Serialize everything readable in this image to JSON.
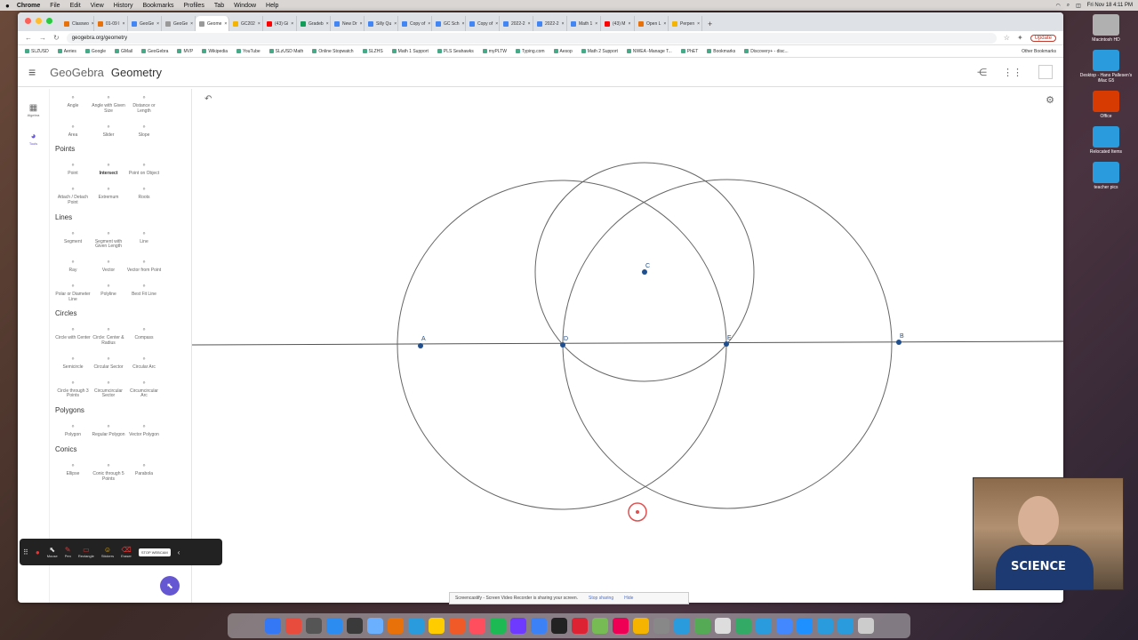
{
  "menubar": {
    "apple": "",
    "items": [
      "Chrome",
      "File",
      "Edit",
      "View",
      "History",
      "Bookmarks",
      "Profiles",
      "Tab",
      "Window",
      "Help"
    ],
    "clock": "Fri Nov 18 4:11 PM"
  },
  "desktop_icons": [
    {
      "label": "Macintosh HD",
      "color": "#b0b0b0"
    },
    {
      "label": "Desktop - Hans Pallesen's iMac G5",
      "color": "#2a9bdc"
    },
    {
      "label": "Office",
      "color": "#d83b01"
    },
    {
      "label": "Relocated Items",
      "color": "#2a9bdc"
    },
    {
      "label": "teacher pics",
      "color": "#2a9bdc"
    }
  ],
  "browser": {
    "tabs": [
      {
        "label": "Classwo",
        "color": "#e8710a"
      },
      {
        "label": "01-09 I",
        "color": "#e8710a"
      },
      {
        "label": "GeoGe",
        "color": "#4285f4"
      },
      {
        "label": "GeoGe",
        "color": "#999"
      },
      {
        "label": "Geome",
        "color": "#999",
        "active": true
      },
      {
        "label": "GC202",
        "color": "#f4b400"
      },
      {
        "label": "(43) Gi",
        "color": "#ff0000"
      },
      {
        "label": "Gradeb",
        "color": "#0f9d58"
      },
      {
        "label": "New Dr",
        "color": "#4285f4"
      },
      {
        "label": "Silly Qu",
        "color": "#4285f4"
      },
      {
        "label": "Copy of",
        "color": "#4285f4"
      },
      {
        "label": "GC Sch",
        "color": "#4285f4"
      },
      {
        "label": "Copy of",
        "color": "#4285f4"
      },
      {
        "label": "2022-2",
        "color": "#4285f4"
      },
      {
        "label": "2022-2",
        "color": "#4285f4"
      },
      {
        "label": "Math 1",
        "color": "#4285f4"
      },
      {
        "label": "(43) M",
        "color": "#ff0000"
      },
      {
        "label": "Open L",
        "color": "#e8710a"
      },
      {
        "label": "Perpen",
        "color": "#f4b400"
      }
    ],
    "url": "geogebra.org/geometry",
    "update_label": "Update",
    "bookmarks": [
      "SLZUSD",
      "Aeries",
      "Google",
      "GMail",
      "GeoGebra",
      "MVP",
      "Wikipedia",
      "YouTube",
      "SLzUSD Math",
      "Online Stopwatch",
      "SLZHS",
      "Math 1 Support",
      "PLS Seahawks",
      "myPLTW",
      "Typing.com",
      "Aesop",
      "Math 2 Support",
      "NWEA -Manage T...",
      "PhET",
      "Bookmarks",
      "Discovery+ - disc..."
    ],
    "other_bookmarks": "Other Bookmarks"
  },
  "geogebra": {
    "brand": "GeoGebra",
    "app_name": "Geometry",
    "rail": [
      {
        "label": "Algebra",
        "icon": "calculator-icon"
      },
      {
        "label": "Tools",
        "icon": "tools-icon",
        "active": true
      }
    ],
    "tool_sections": [
      {
        "title": "",
        "rows": [
          [
            {
              "label": "Angle",
              "icon": "angle-icon"
            },
            {
              "label": "Angle with Given Size",
              "icon": "angle-size-icon"
            },
            {
              "label": "Distance or Length",
              "icon": "distance-icon"
            }
          ],
          [
            {
              "label": "Area",
              "icon": "area-icon"
            },
            {
              "label": "Slider",
              "icon": "slider-icon"
            },
            {
              "label": "Slope",
              "icon": "slope-icon"
            }
          ]
        ]
      },
      {
        "title": "Points",
        "rows": [
          [
            {
              "label": "Point",
              "icon": "point-icon"
            },
            {
              "label": "Intersect",
              "icon": "intersect-icon",
              "selected": true
            },
            {
              "label": "Point on Object",
              "icon": "point-on-object-icon"
            }
          ],
          [
            {
              "label": "Attach / Detach Point",
              "icon": "attach-icon"
            },
            {
              "label": "Extremum",
              "icon": "extremum-icon"
            },
            {
              "label": "Roots",
              "icon": "roots-icon"
            }
          ]
        ]
      },
      {
        "title": "Lines",
        "rows": [
          [
            {
              "label": "Segment",
              "icon": "segment-icon"
            },
            {
              "label": "Segment with Given Length",
              "icon": "segment-length-icon"
            },
            {
              "label": "Line",
              "icon": "line-icon"
            }
          ],
          [
            {
              "label": "Ray",
              "icon": "ray-icon"
            },
            {
              "label": "Vector",
              "icon": "vector-icon"
            },
            {
              "label": "Vector from Point",
              "icon": "vector-from-point-icon"
            }
          ],
          [
            {
              "label": "Polar or Diameter Line",
              "icon": "polar-icon"
            },
            {
              "label": "Polyline",
              "icon": "polyline-icon"
            },
            {
              "label": "Best Fit Line",
              "icon": "best-fit-icon"
            }
          ]
        ]
      },
      {
        "title": "Circles",
        "rows": [
          [
            {
              "label": "Circle with Center",
              "icon": "circle-center-icon"
            },
            {
              "label": "Circle: Center & Radius",
              "icon": "circle-radius-icon"
            },
            {
              "label": "Compass",
              "icon": "compass-icon"
            }
          ],
          [
            {
              "label": "Semicircle",
              "icon": "semicircle-icon"
            },
            {
              "label": "Circular Sector",
              "icon": "sector-icon"
            },
            {
              "label": "Circular Arc",
              "icon": "arc-icon"
            }
          ],
          [
            {
              "label": "Circle through 3 Points",
              "icon": "circle-3pts-icon"
            },
            {
              "label": "Circumcircular Sector",
              "icon": "circumsector-icon"
            },
            {
              "label": "Circumcircular Arc",
              "icon": "circumarc-icon"
            }
          ]
        ]
      },
      {
        "title": "Polygons",
        "rows": [
          [
            {
              "label": "Polygon",
              "icon": "polygon-icon"
            },
            {
              "label": "Regular Polygon",
              "icon": "regular-polygon-icon"
            },
            {
              "label": "Vector Polygon",
              "icon": "vector-polygon-icon"
            }
          ]
        ]
      },
      {
        "title": "Conics",
        "rows": [
          [
            {
              "label": "Ellipse",
              "icon": "ellipse-icon"
            },
            {
              "label": "Conic through 5 Points",
              "icon": "conic-icon"
            },
            {
              "label": "Parabola",
              "icon": "parabola-icon"
            }
          ]
        ]
      }
    ],
    "points": [
      "A",
      "B",
      "C",
      "D",
      "E"
    ]
  },
  "screencastify": {
    "tools": [
      "Mouse",
      "Pen",
      "Rectangle",
      "Stickers",
      "Eraser"
    ],
    "stop_label": "STOP WEBCAM",
    "share_text": "Screencastify - Screen Video Recorder is sharing your screen.",
    "stop_sharing": "Stop sharing",
    "hide": "Hide"
  },
  "webcam": {
    "shirt_text": "SCIENCE"
  },
  "dock_colors": [
    "#3478f6",
    "#e74c3c",
    "#555",
    "#2d8cf0",
    "#3a3a3a",
    "#6ab0ff",
    "#e8710a",
    "#2a9bdc",
    "#ffcc00",
    "#f05a28",
    "#ff4f5e",
    "#1db954",
    "#6e3aff",
    "#3c82f6",
    "#222",
    "#d23",
    "#7b5",
    "#e05",
    "#f4b400",
    "#888",
    "#2a9bdc",
    "#5a5",
    "#ddd",
    "#3a6",
    "#2a9bdc",
    "#48f",
    "#1e90ff",
    "#2a9bdc",
    "#2a9bdc",
    "#ccc"
  ]
}
